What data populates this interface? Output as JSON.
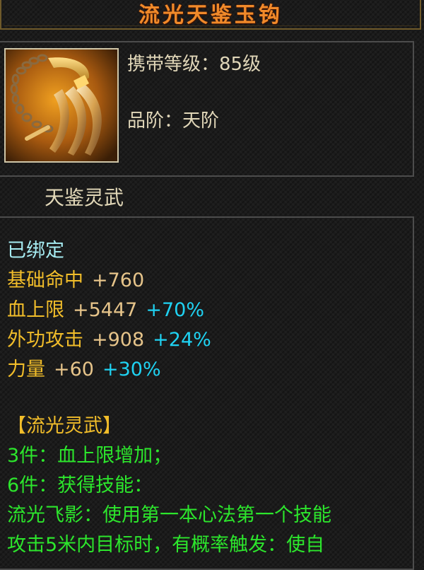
{
  "title": "流光天鉴玉钩",
  "icon": "golden-hook-weapon-icon",
  "info": {
    "level": "携带等级：85级",
    "grade": "品阶：天阶"
  },
  "subtitle": "天鉴灵武",
  "attributes": {
    "bound": "已绑定",
    "items": [
      {
        "name": "基础命中",
        "value": "+760",
        "percent": ""
      },
      {
        "name": "血上限",
        "value": "+5447",
        "percent": "+70%"
      },
      {
        "name": "外功攻击",
        "value": "+908",
        "percent": "+24%"
      },
      {
        "name": "力量",
        "value": "+60",
        "percent": "+30%"
      }
    ]
  },
  "set": {
    "name": "【流光灵武】",
    "lines": [
      "3件：血上限增加；",
      "6件：获得技能：",
      "流光飞影：使用第一本心法第一个技能",
      "攻击5米内目标时，有概率触发：使自"
    ]
  },
  "colors": {
    "title": "#f08a2a",
    "bound": "#a6ecf2",
    "attribute": "#f1bd2a",
    "percent": "#1fd2f2",
    "set": "#2ce62c"
  }
}
